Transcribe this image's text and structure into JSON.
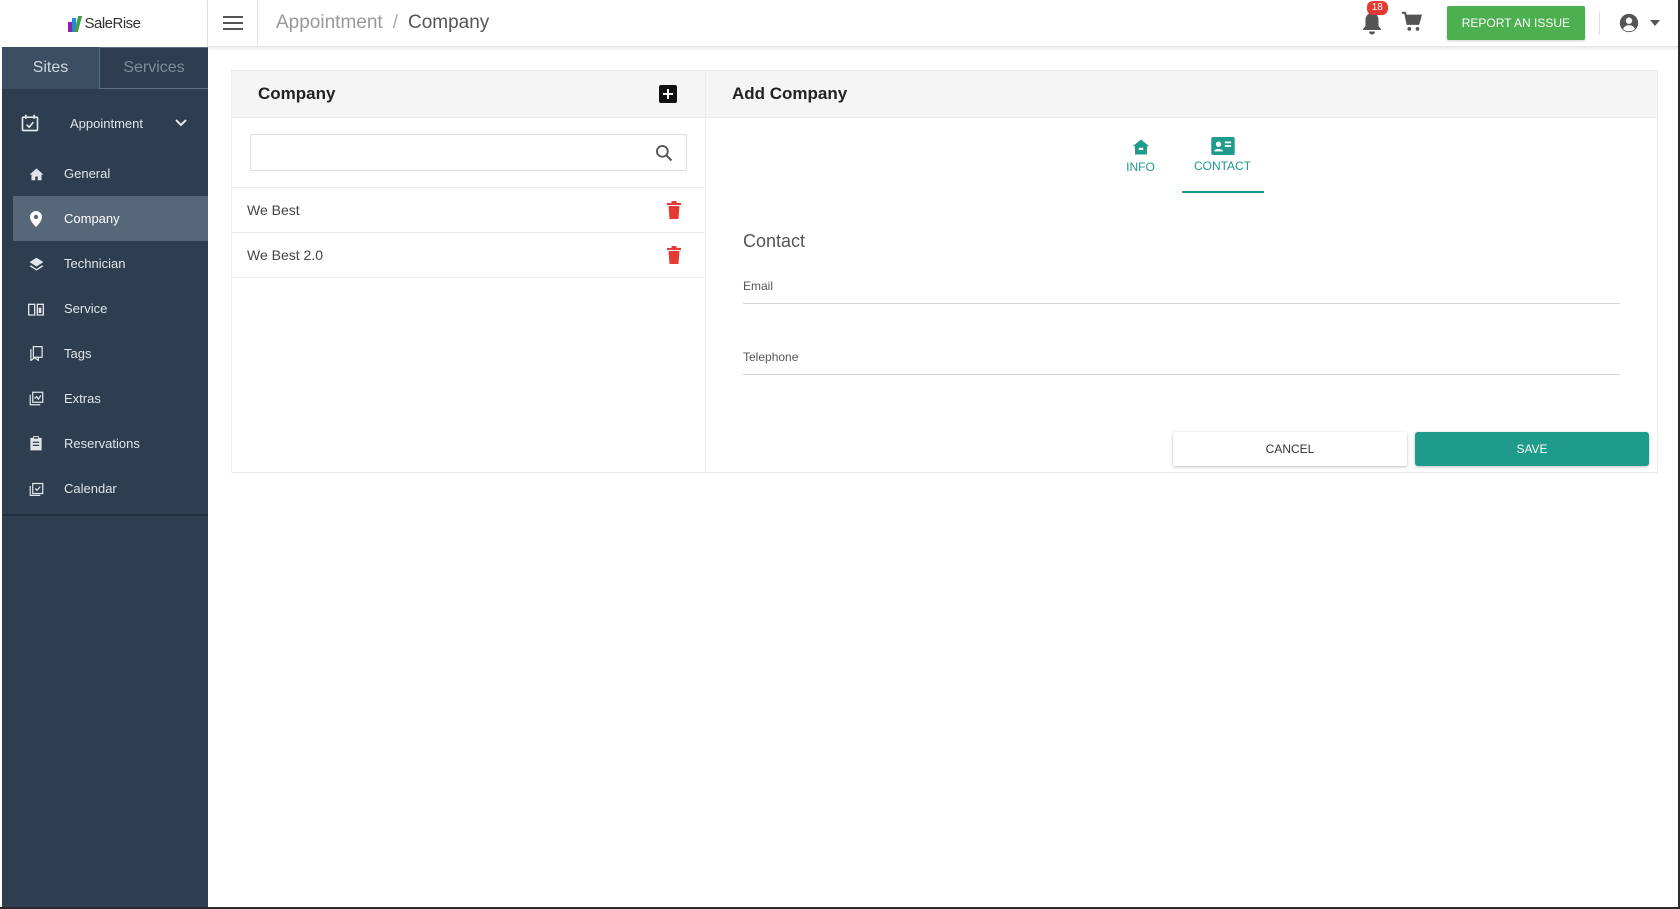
{
  "brand": {
    "name": "SaleRise",
    "colors": [
      "#8e24aa",
      "#1e88e5",
      "#43a047",
      "#fb8c00"
    ]
  },
  "sidebar": {
    "tabs": [
      {
        "label": "Sites",
        "active": true
      },
      {
        "label": "Services",
        "active": false
      }
    ],
    "section": {
      "label": "Appointment",
      "icon": "calendar-check-icon"
    },
    "items": [
      {
        "label": "General",
        "icon": "home-icon"
      },
      {
        "label": "Company",
        "icon": "map-pin-icon",
        "active": true
      },
      {
        "label": "Technician",
        "icon": "layers-icon"
      },
      {
        "label": "Service",
        "icon": "book-icon"
      },
      {
        "label": "Tags",
        "icon": "bookmark-icon"
      },
      {
        "label": "Extras",
        "icon": "gallery-icon"
      },
      {
        "label": "Reservations",
        "icon": "clipboard-icon"
      },
      {
        "label": "Calendar",
        "icon": "calendar-icon"
      }
    ]
  },
  "topbar": {
    "breadcrumb": [
      "Appointment",
      "Company"
    ],
    "breadcrumb_separator": "/",
    "notifications_count": "18",
    "report_label": "REPORT AN ISSUE"
  },
  "company_list": {
    "title": "Company",
    "search": {
      "value": "",
      "placeholder": ""
    },
    "items": [
      "We Best",
      "We Best 2.0"
    ]
  },
  "form": {
    "title": "Add Company",
    "tabs": [
      {
        "label": "INFO",
        "icon": "home-icon"
      },
      {
        "label": "CONTACT",
        "icon": "contact-card-icon",
        "active": true
      }
    ],
    "section_title": "Contact",
    "email": {
      "placeholder": "Email",
      "value": ""
    },
    "telephone": {
      "placeholder": "Telephone",
      "value": ""
    },
    "cancel_label": "CANCEL",
    "save_label": "SAVE",
    "accent_color": "#1e9b8a"
  }
}
